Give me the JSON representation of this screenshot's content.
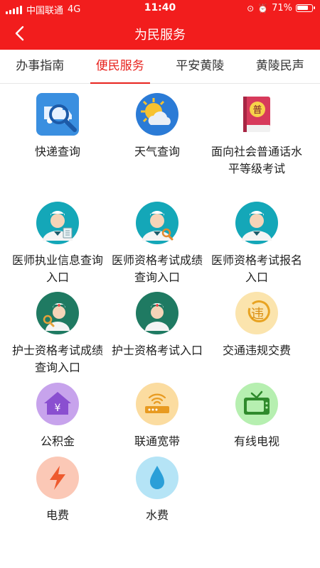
{
  "status_bar": {
    "carrier": "中国联通",
    "network": "4G",
    "time": "11:40",
    "battery": "71%"
  },
  "header": {
    "title": "为民服务",
    "back_icon": "chevron-left-icon",
    "color": "#f21d1d"
  },
  "tabs": [
    {
      "label": "办事指南",
      "active": false
    },
    {
      "label": "便民服务",
      "active": true
    },
    {
      "label": "平安黄陵",
      "active": false
    },
    {
      "label": "黄陵民声",
      "active": false
    }
  ],
  "services": [
    {
      "label": "快递查询",
      "icon": "express-search-icon"
    },
    {
      "label": "天气查询",
      "icon": "weather-icon"
    },
    {
      "label": "面向社会普通话水平等级考试",
      "icon": "mandarin-book-icon"
    },
    {
      "label": "医师执业信息查询入口",
      "icon": "doctor-list-icon"
    },
    {
      "label": "医师资格考试成绩查询入口",
      "icon": "doctor-search-icon"
    },
    {
      "label": "医师资格考试报名入口",
      "icon": "doctor-icon"
    },
    {
      "label": "护士资格考试成绩查询入口",
      "icon": "nurse-search-icon"
    },
    {
      "label": "护士资格考试入口",
      "icon": "nurse-icon"
    },
    {
      "label": "交通违规交费",
      "icon": "traffic-fine-icon"
    },
    {
      "label": "公积金",
      "icon": "housing-fund-icon"
    },
    {
      "label": "联通宽带",
      "icon": "broadband-router-icon"
    },
    {
      "label": "有线电视",
      "icon": "tv-icon"
    },
    {
      "label": "电费",
      "icon": "lightning-icon"
    },
    {
      "label": "水费",
      "icon": "water-drop-icon"
    }
  ]
}
